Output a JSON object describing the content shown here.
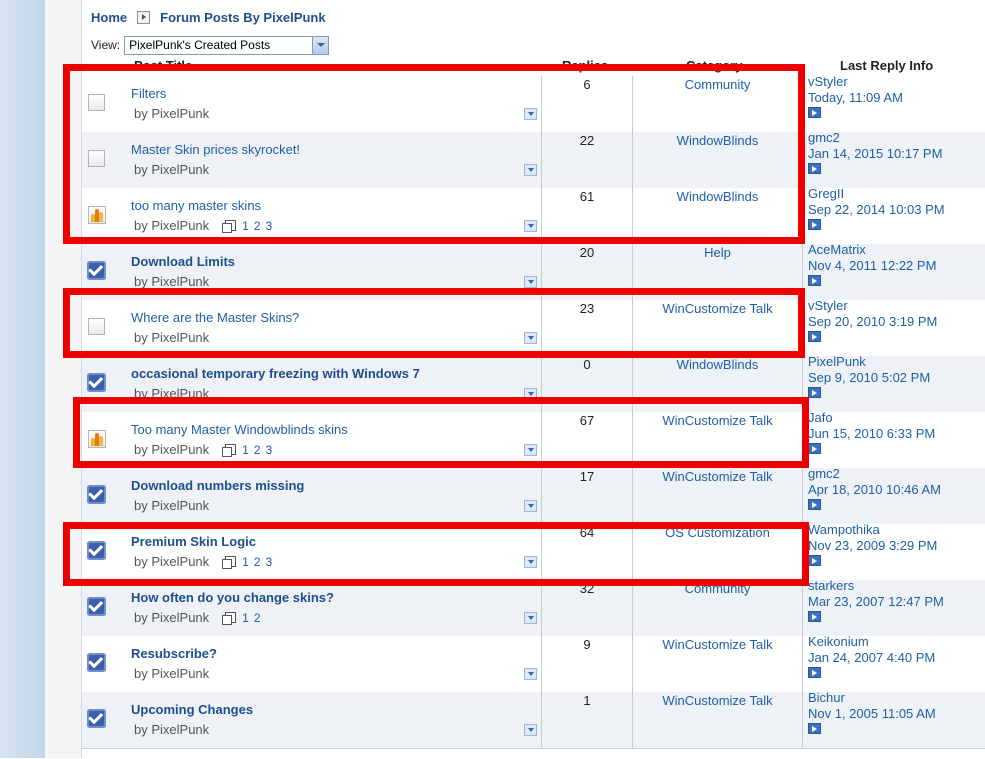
{
  "breadcrumb": {
    "home": "Home",
    "current": "Forum Posts By PixelPunk"
  },
  "view": {
    "label": "View:",
    "selected": "PixelPunk's Created Posts"
  },
  "columns": {
    "title": "Post Title",
    "replies": "Replies",
    "category": "Category",
    "last_reply": "Last Reply Info"
  },
  "posts": [
    {
      "title": "Filters",
      "bold": false,
      "status": "new",
      "author": "by PixelPunk",
      "pages": [],
      "replies": "6",
      "category": "Community",
      "last_user": "vStyler",
      "last_date": "Today, 11:09 AM"
    },
    {
      "title": "Master Skin prices skyrocket!",
      "bold": false,
      "status": "new",
      "author": "by PixelPunk",
      "pages": [],
      "replies": "22",
      "category": "WindowBlinds",
      "last_user": "gmc2",
      "last_date": "Jan 14, 2015 10:17 PM"
    },
    {
      "title": "too many master skins",
      "bold": false,
      "status": "hot",
      "author": "by PixelPunk",
      "pages": [
        "1",
        "2",
        "3"
      ],
      "replies": "61",
      "category": "WindowBlinds",
      "last_user": "GregII",
      "last_date": "Sep 22, 2014 10:03 PM"
    },
    {
      "title": "Download Limits",
      "bold": true,
      "status": "read",
      "author": "by PixelPunk",
      "pages": [],
      "replies": "20",
      "category": "Help",
      "last_user": "AceMatrix",
      "last_date": "Nov 4, 2011 12:22 PM"
    },
    {
      "title": "Where are the Master Skins?",
      "bold": false,
      "status": "new",
      "author": "by PixelPunk",
      "pages": [],
      "replies": "23",
      "category": "WinCustomize Talk",
      "last_user": "vStyler",
      "last_date": "Sep 20, 2010 3:19 PM"
    },
    {
      "title": "occasional temporary freezing with Windows 7",
      "bold": true,
      "status": "read",
      "author": "by PixelPunk",
      "pages": [],
      "replies": "0",
      "category": "WindowBlinds",
      "last_user": "PixelPunk",
      "last_date": "Sep 9, 2010 5:02 PM"
    },
    {
      "title": "Too many Master Windowblinds skins",
      "bold": false,
      "status": "hot",
      "author": "by PixelPunk",
      "pages": [
        "1",
        "2",
        "3"
      ],
      "replies": "67",
      "category": "WinCustomize Talk",
      "last_user": "Jafo",
      "last_date": "Jun 15, 2010 6:33 PM"
    },
    {
      "title": "Download numbers missing",
      "bold": true,
      "status": "read",
      "author": "by PixelPunk",
      "pages": [],
      "replies": "17",
      "category": "WinCustomize Talk",
      "last_user": "gmc2",
      "last_date": "Apr 18, 2010 10:46 AM"
    },
    {
      "title": "Premium Skin Logic",
      "bold": true,
      "status": "read",
      "author": "by PixelPunk",
      "pages": [
        "1",
        "2",
        "3"
      ],
      "replies": "64",
      "category": "OS Customization",
      "last_user": "Wampothika",
      "last_date": "Nov 23, 2009 3:29 PM"
    },
    {
      "title": "How often do you change skins?",
      "bold": true,
      "status": "read",
      "author": "by PixelPunk",
      "pages": [
        "1",
        "2"
      ],
      "replies": "32",
      "category": "Community",
      "last_user": "starkers",
      "last_date": "Mar 23, 2007 12:47 PM"
    },
    {
      "title": "Resubscribe?",
      "bold": true,
      "status": "read",
      "author": "by PixelPunk",
      "pages": [],
      "replies": "9",
      "category": "WinCustomize Talk",
      "last_user": "Keikonium",
      "last_date": "Jan 24, 2007 4:40 PM"
    },
    {
      "title": "Upcoming Changes",
      "bold": true,
      "status": "read",
      "author": "by PixelPunk",
      "pages": [],
      "replies": "1",
      "category": "WinCustomize Talk",
      "last_user": "Bichur",
      "last_date": "Nov 1, 2005 11:05 AM"
    }
  ],
  "colors": {
    "link": "#1f5fa8",
    "highlight": "#ee0000",
    "row_alt": "#eef1f5"
  }
}
